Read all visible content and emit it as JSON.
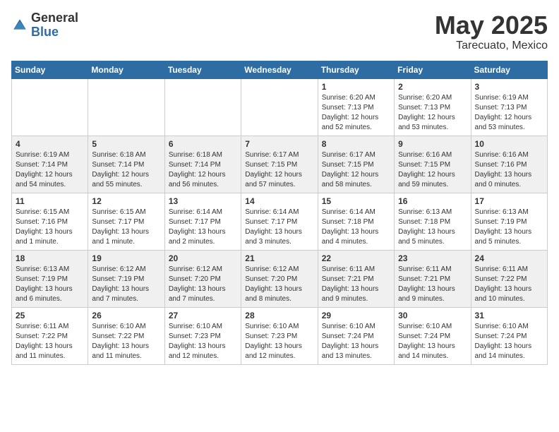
{
  "header": {
    "logo_general": "General",
    "logo_blue": "Blue",
    "month": "May 2025",
    "location": "Tarecuato, Mexico"
  },
  "days_of_week": [
    "Sunday",
    "Monday",
    "Tuesday",
    "Wednesday",
    "Thursday",
    "Friday",
    "Saturday"
  ],
  "weeks": [
    [
      {
        "day": "",
        "info": ""
      },
      {
        "day": "",
        "info": ""
      },
      {
        "day": "",
        "info": ""
      },
      {
        "day": "",
        "info": ""
      },
      {
        "day": "1",
        "info": "Sunrise: 6:20 AM\nSunset: 7:13 PM\nDaylight: 12 hours\nand 52 minutes."
      },
      {
        "day": "2",
        "info": "Sunrise: 6:20 AM\nSunset: 7:13 PM\nDaylight: 12 hours\nand 53 minutes."
      },
      {
        "day": "3",
        "info": "Sunrise: 6:19 AM\nSunset: 7:13 PM\nDaylight: 12 hours\nand 53 minutes."
      }
    ],
    [
      {
        "day": "4",
        "info": "Sunrise: 6:19 AM\nSunset: 7:14 PM\nDaylight: 12 hours\nand 54 minutes."
      },
      {
        "day": "5",
        "info": "Sunrise: 6:18 AM\nSunset: 7:14 PM\nDaylight: 12 hours\nand 55 minutes."
      },
      {
        "day": "6",
        "info": "Sunrise: 6:18 AM\nSunset: 7:14 PM\nDaylight: 12 hours\nand 56 minutes."
      },
      {
        "day": "7",
        "info": "Sunrise: 6:17 AM\nSunset: 7:15 PM\nDaylight: 12 hours\nand 57 minutes."
      },
      {
        "day": "8",
        "info": "Sunrise: 6:17 AM\nSunset: 7:15 PM\nDaylight: 12 hours\nand 58 minutes."
      },
      {
        "day": "9",
        "info": "Sunrise: 6:16 AM\nSunset: 7:15 PM\nDaylight: 12 hours\nand 59 minutes."
      },
      {
        "day": "10",
        "info": "Sunrise: 6:16 AM\nSunset: 7:16 PM\nDaylight: 13 hours\nand 0 minutes."
      }
    ],
    [
      {
        "day": "11",
        "info": "Sunrise: 6:15 AM\nSunset: 7:16 PM\nDaylight: 13 hours\nand 1 minute."
      },
      {
        "day": "12",
        "info": "Sunrise: 6:15 AM\nSunset: 7:17 PM\nDaylight: 13 hours\nand 1 minute."
      },
      {
        "day": "13",
        "info": "Sunrise: 6:14 AM\nSunset: 7:17 PM\nDaylight: 13 hours\nand 2 minutes."
      },
      {
        "day": "14",
        "info": "Sunrise: 6:14 AM\nSunset: 7:17 PM\nDaylight: 13 hours\nand 3 minutes."
      },
      {
        "day": "15",
        "info": "Sunrise: 6:14 AM\nSunset: 7:18 PM\nDaylight: 13 hours\nand 4 minutes."
      },
      {
        "day": "16",
        "info": "Sunrise: 6:13 AM\nSunset: 7:18 PM\nDaylight: 13 hours\nand 5 minutes."
      },
      {
        "day": "17",
        "info": "Sunrise: 6:13 AM\nSunset: 7:19 PM\nDaylight: 13 hours\nand 5 minutes."
      }
    ],
    [
      {
        "day": "18",
        "info": "Sunrise: 6:13 AM\nSunset: 7:19 PM\nDaylight: 13 hours\nand 6 minutes."
      },
      {
        "day": "19",
        "info": "Sunrise: 6:12 AM\nSunset: 7:19 PM\nDaylight: 13 hours\nand 7 minutes."
      },
      {
        "day": "20",
        "info": "Sunrise: 6:12 AM\nSunset: 7:20 PM\nDaylight: 13 hours\nand 7 minutes."
      },
      {
        "day": "21",
        "info": "Sunrise: 6:12 AM\nSunset: 7:20 PM\nDaylight: 13 hours\nand 8 minutes."
      },
      {
        "day": "22",
        "info": "Sunrise: 6:11 AM\nSunset: 7:21 PM\nDaylight: 13 hours\nand 9 minutes."
      },
      {
        "day": "23",
        "info": "Sunrise: 6:11 AM\nSunset: 7:21 PM\nDaylight: 13 hours\nand 9 minutes."
      },
      {
        "day": "24",
        "info": "Sunrise: 6:11 AM\nSunset: 7:22 PM\nDaylight: 13 hours\nand 10 minutes."
      }
    ],
    [
      {
        "day": "25",
        "info": "Sunrise: 6:11 AM\nSunset: 7:22 PM\nDaylight: 13 hours\nand 11 minutes."
      },
      {
        "day": "26",
        "info": "Sunrise: 6:10 AM\nSunset: 7:22 PM\nDaylight: 13 hours\nand 11 minutes."
      },
      {
        "day": "27",
        "info": "Sunrise: 6:10 AM\nSunset: 7:23 PM\nDaylight: 13 hours\nand 12 minutes."
      },
      {
        "day": "28",
        "info": "Sunrise: 6:10 AM\nSunset: 7:23 PM\nDaylight: 13 hours\nand 12 minutes."
      },
      {
        "day": "29",
        "info": "Sunrise: 6:10 AM\nSunset: 7:24 PM\nDaylight: 13 hours\nand 13 minutes."
      },
      {
        "day": "30",
        "info": "Sunrise: 6:10 AM\nSunset: 7:24 PM\nDaylight: 13 hours\nand 14 minutes."
      },
      {
        "day": "31",
        "info": "Sunrise: 6:10 AM\nSunset: 7:24 PM\nDaylight: 13 hours\nand 14 minutes."
      }
    ]
  ]
}
